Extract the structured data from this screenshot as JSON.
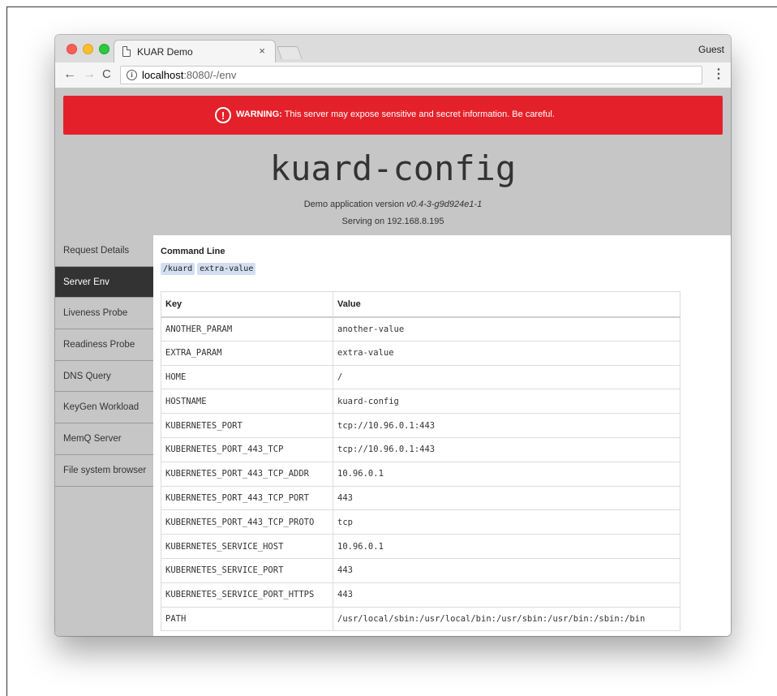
{
  "browser": {
    "tab_title": "KUAR Demo",
    "tab_close": "×",
    "profile": "Guest",
    "url_host": "localhost",
    "url_rest": ":8080/-/env",
    "info_glyph": "i",
    "back_glyph": "←",
    "forward_glyph": "→",
    "reload_glyph": "C",
    "menu_glyph": "⋮"
  },
  "warning": {
    "icon": "!",
    "label": "WARNING:",
    "message": " This server may expose sensitive and secret information. Be careful."
  },
  "header": {
    "title": "kuard-config",
    "version_prefix": "Demo application version ",
    "version": "v0.4-3-g9d924e1-1",
    "serving": "Serving on 192.168.8.195"
  },
  "sidebar": {
    "items": [
      {
        "label": "Request Details"
      },
      {
        "label": "Server Env"
      },
      {
        "label": "Liveness Probe"
      },
      {
        "label": "Readiness Probe"
      },
      {
        "label": "DNS Query"
      },
      {
        "label": "KeyGen Workload"
      },
      {
        "label": "MemQ Server"
      },
      {
        "label": "File system browser"
      }
    ],
    "active_index": 1
  },
  "command_line": {
    "title": "Command Line",
    "args": [
      "/kuard",
      "extra-value"
    ]
  },
  "env_table": {
    "headers": {
      "key": "Key",
      "value": "Value"
    },
    "rows": [
      {
        "key": "ANOTHER_PARAM",
        "value": "another-value"
      },
      {
        "key": "EXTRA_PARAM",
        "value": "extra-value"
      },
      {
        "key": "HOME",
        "value": "/"
      },
      {
        "key": "HOSTNAME",
        "value": "kuard-config"
      },
      {
        "key": "KUBERNETES_PORT",
        "value": "tcp://10.96.0.1:443"
      },
      {
        "key": "KUBERNETES_PORT_443_TCP",
        "value": "tcp://10.96.0.1:443"
      },
      {
        "key": "KUBERNETES_PORT_443_TCP_ADDR",
        "value": "10.96.0.1"
      },
      {
        "key": "KUBERNETES_PORT_443_TCP_PORT",
        "value": "443"
      },
      {
        "key": "KUBERNETES_PORT_443_TCP_PROTO",
        "value": "tcp"
      },
      {
        "key": "KUBERNETES_SERVICE_HOST",
        "value": "10.96.0.1"
      },
      {
        "key": "KUBERNETES_SERVICE_PORT",
        "value": "443"
      },
      {
        "key": "KUBERNETES_SERVICE_PORT_HTTPS",
        "value": "443"
      },
      {
        "key": "PATH",
        "value": "/usr/local/sbin:/usr/local/bin:/usr/sbin:/usr/bin:/sbin:/bin"
      }
    ]
  },
  "colors": {
    "warning_bg": "#e4212a",
    "header_bg": "#c6c6c6",
    "active_item_bg": "#333333",
    "arg_bg": "#d3dff0"
  }
}
